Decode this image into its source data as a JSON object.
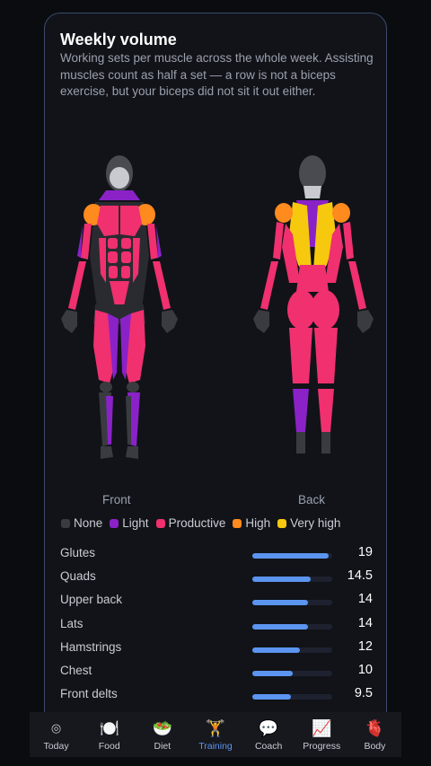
{
  "card": {
    "title": "Weekly volume",
    "subtitle": "Working sets per muscle across the whole week. Assisting muscles count as half a set — a row is not a biceps exercise, but your biceps did not sit it out either."
  },
  "figures": {
    "front_label": "Front",
    "back_label": "Back"
  },
  "colors": {
    "none": "#3a3b40",
    "light": "#8a22c8",
    "productive": "#f0306f",
    "high": "#ff8a1e",
    "very_high": "#f6c90e",
    "accent": "#5b95f0"
  },
  "legend": [
    {
      "label": "None",
      "color": "#3a3b40"
    },
    {
      "label": "Light",
      "color": "#8a22c8"
    },
    {
      "label": "Productive",
      "color": "#f0306f"
    },
    {
      "label": "High",
      "color": "#ff8a1e"
    },
    {
      "label": "Very high",
      "color": "#f6c90e"
    }
  ],
  "muscles": [
    {
      "name": "Glutes",
      "sets": "19",
      "fraction": 0.95
    },
    {
      "name": "Quads",
      "sets": "14.5",
      "fraction": 0.73
    },
    {
      "name": "Upper back",
      "sets": "14",
      "fraction": 0.7
    },
    {
      "name": "Lats",
      "sets": "14",
      "fraction": 0.7
    },
    {
      "name": "Hamstrings",
      "sets": "12",
      "fraction": 0.6
    },
    {
      "name": "Chest",
      "sets": "10",
      "fraction": 0.5
    },
    {
      "name": "Front delts",
      "sets": "9.5",
      "fraction": 0.48
    }
  ],
  "nav": [
    {
      "label": "Today",
      "icon": "target-icon",
      "glyph": "◎",
      "active": false
    },
    {
      "label": "Food",
      "icon": "plate-icon",
      "glyph": "🍽️",
      "active": false
    },
    {
      "label": "Diet",
      "icon": "salad-icon",
      "glyph": "🥗",
      "active": false
    },
    {
      "label": "Training",
      "icon": "weightlifter-icon",
      "glyph": "🏋️",
      "active": true
    },
    {
      "label": "Coach",
      "icon": "speech-bubble-icon",
      "glyph": "💬",
      "active": false
    },
    {
      "label": "Progress",
      "icon": "chart-icon",
      "glyph": "📈",
      "active": false
    },
    {
      "label": "Body",
      "icon": "anatomical-heart-icon",
      "glyph": "🫀",
      "active": false
    }
  ]
}
